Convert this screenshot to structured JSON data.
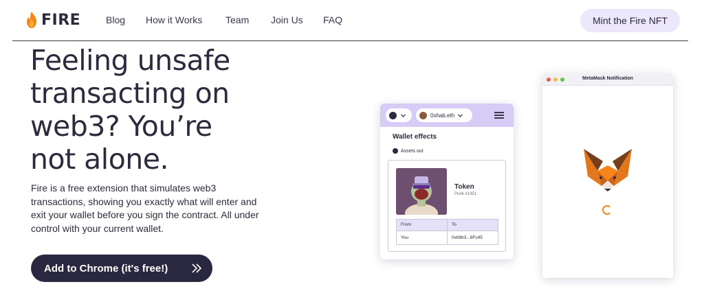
{
  "brand": {
    "name": "FIRE"
  },
  "nav": {
    "links": [
      {
        "label": "Blog"
      },
      {
        "label": "How it Works"
      },
      {
        "label": "Team"
      },
      {
        "label": "Join Us"
      },
      {
        "label": "FAQ"
      }
    ],
    "cta_label": "Mint the Fire NFT"
  },
  "hero": {
    "title_lines": [
      "Feeling unsafe",
      "transacting on",
      "web3? You’re",
      "not alone."
    ],
    "description": "Fire is a free extension that simulates web3 transactions, showing you exactly what will enter and exit your wallet before you sign the contract. All under control with your current wallet.",
    "cta_label": "Add to Chrome (it's free!)"
  },
  "extension": {
    "account": "0xhab.eth",
    "section_title": "Wallet effects",
    "assets_label": "Assets out",
    "token_name": "Token",
    "token_sub": "Punk #1351",
    "table": {
      "headers": [
        "From",
        "To"
      ],
      "row": [
        "You",
        "0x68b3...8Fc45"
      ]
    }
  },
  "metamask": {
    "title": "MetaMask Notification"
  },
  "colors": {
    "text": "#2d2a3e",
    "accent_light": "#ece7fb",
    "cta_bg": "#2a2840",
    "extension_header": "#d7ccf5",
    "fox_orange": "#f6851b"
  },
  "icons": [
    "flame-icon",
    "chevron-double-right-icon",
    "chevron-down-icon",
    "menu-icon",
    "metamask-fox-icon",
    "loading-spinner-icon"
  ]
}
